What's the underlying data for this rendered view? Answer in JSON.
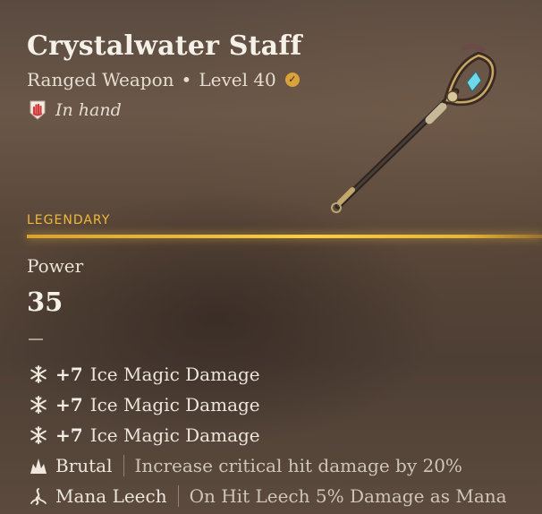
{
  "item": {
    "name": "Crystalwater Staff",
    "type": "Ranged Weapon",
    "separator": "•",
    "level": "Level 40",
    "status": "In hand",
    "rarity": "LEGENDARY"
  },
  "stat": {
    "label": "Power",
    "value": "35"
  },
  "colors": {
    "legendary": "#f1b83a",
    "text": "#ece6dc"
  },
  "modifiers": [
    {
      "icon": "snowflake-icon",
      "amount": "+7",
      "label": "Ice Magic Damage"
    },
    {
      "icon": "snowflake-icon",
      "amount": "+7",
      "label": "Ice Magic Damage"
    },
    {
      "icon": "snowflake-icon",
      "amount": "+7",
      "label": "Ice Magic Damage"
    }
  ],
  "perks": [
    {
      "icon": "brutal-icon",
      "name": "Brutal",
      "description": "Increase critical hit damage by 20%"
    },
    {
      "icon": "mana-leech-icon",
      "name": "Mana Leech",
      "description": "On Hit Leech 5% Damage as Mana"
    }
  ]
}
